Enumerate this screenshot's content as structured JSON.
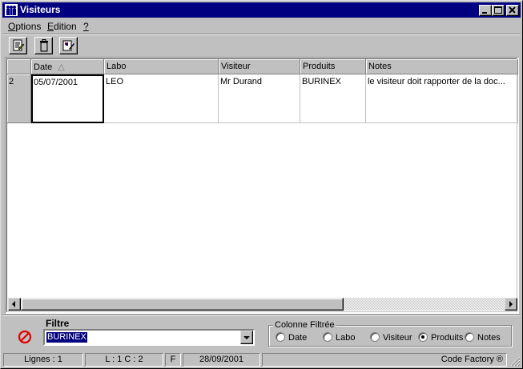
{
  "window": {
    "title": "Visiteurs"
  },
  "menu": [
    "Options",
    "Edition",
    "?"
  ],
  "menu_underline": [
    "O",
    "E",
    "?"
  ],
  "menu_rest": [
    "ptions",
    "dition",
    ""
  ],
  "toolbar": {
    "icons": [
      "edit-icon",
      "trash-icon",
      "print-icon"
    ]
  },
  "grid": {
    "columns": [
      "Date",
      "Labo",
      "Visiteur",
      "Produits",
      "Notes"
    ],
    "sort_indicator": "△",
    "rows": [
      {
        "num": "2",
        "cells": [
          "05/07/2001",
          "LEO",
          "Mr Durand",
          "BURINEX",
          "le visiteur doit rapporter de la doc..."
        ]
      }
    ]
  },
  "filter": {
    "label": "Filtre",
    "value": "BURINEX",
    "group_title": "Colonne Filtrée",
    "options": [
      "Date",
      "Labo",
      "Visiteur",
      "Produits",
      "Notes"
    ],
    "selected": "Produits"
  },
  "status": [
    "Lignes : 1",
    "L : 1 C : 2",
    "F",
    "28/09/2001",
    "Code Factory ®"
  ],
  "colors": {
    "title_bar": "#000080",
    "face": "#c0c0c0",
    "forbid": "#e00000"
  }
}
